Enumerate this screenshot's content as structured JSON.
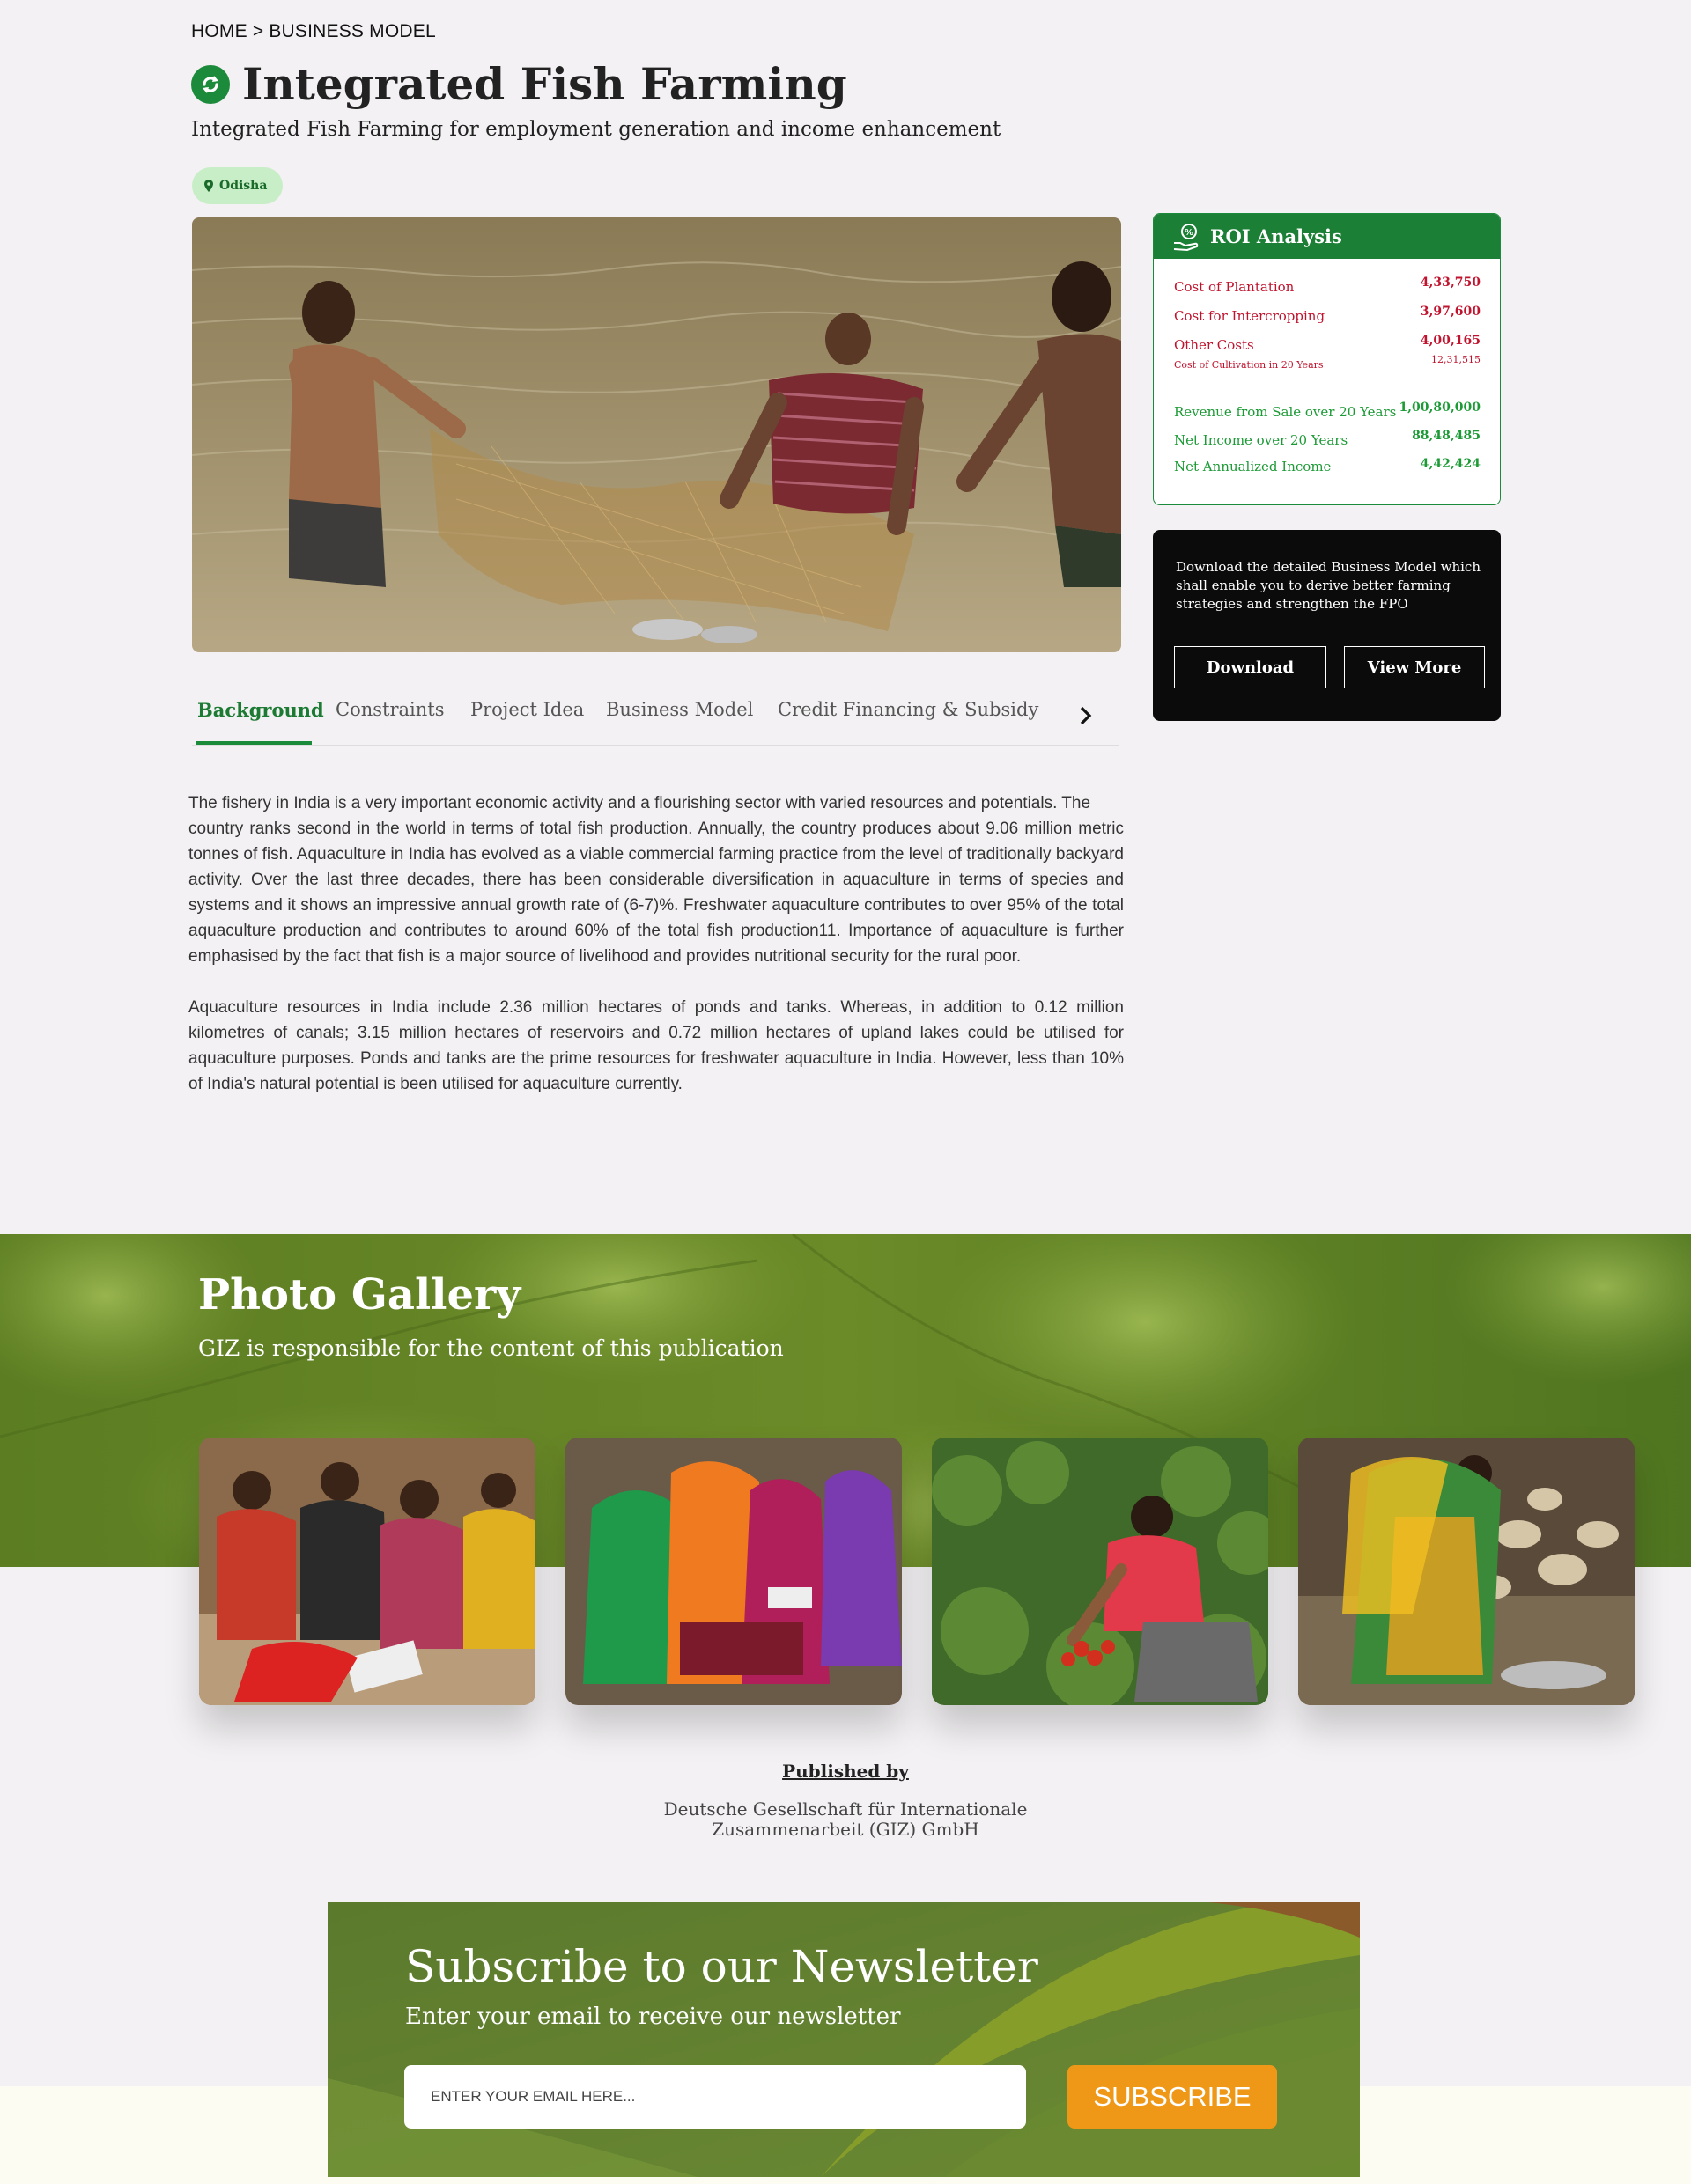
{
  "breadcrumb": "HOME > BUSINESS MODEL",
  "page": {
    "title": "Integrated Fish Farming",
    "subtitle": "Integrated Fish Farming for employment generation and income enhancement",
    "location_tag": "Odisha"
  },
  "tabs": [
    "Background",
    "Constraints",
    "Project Idea",
    "Business Model",
    "Credit Financing & Subsidy"
  ],
  "active_tab": "Background",
  "content": {
    "paragraphs": [
      "The fishery in India is a very important economic activity and a flourishing sector with varied resources and potentials. The\ncountry ranks second in the world in terms of total fish production. Annually, the country produces about 9.06 million metric tonnes of fish. Aquaculture in India has evolved as a viable commercial farming practice from the level of traditionally backyard activity. Over the last three decades, there has been considerable diversification in aquaculture in terms of species and systems and it shows an impressive annual growth rate of (6-7)%. Freshwater aquaculture contributes to over 95% of the total aquaculture production and contributes to around 60% of the total fish production11. Importance of aquaculture is further emphasised by the fact that fish is a major source of livelihood and provides nutritional security for the rural poor.",
      "Aquaculture resources in India include 2.36 million hectares of ponds and tanks. Whereas, in addition to 0.12 million kilometres of canals; 3.15 million hectares of reservoirs and 0.72 million hectares of upland lakes could be utilised for aquaculture purposes. Ponds and tanks are the prime resources for freshwater aquaculture in India. However, less than 10% of India's natural potential is been utilised for aquaculture currently."
    ]
  },
  "roi": {
    "title": "ROI Analysis",
    "rows": [
      {
        "label": "Cost of Plantation",
        "value": "4,33,750"
      },
      {
        "label": "Cost for Intercropping",
        "value": "3,97,600"
      },
      {
        "label": "Other Costs",
        "value": "4,00,165"
      },
      {
        "label": "Cost of Cultivation in 20 Years",
        "value": "12,31,515"
      },
      {
        "label": "Revenue from Sale over 20 Years",
        "value": "1,00,80,000"
      },
      {
        "label": "Net Income over 20 Years",
        "value": "88,48,485"
      },
      {
        "label": "Net Annualized Income",
        "value": "4,42,424"
      }
    ]
  },
  "download_card": {
    "text": "Download the detailed Business Model which shall enable you to derive better farming strategies and strengthen the FPO",
    "download_label": "Download",
    "view_more_label": "View More"
  },
  "gallery": {
    "title": "Photo Gallery",
    "subtitle": "GIZ is responsible for the content of this publication"
  },
  "published": {
    "label": "Published by",
    "org": "Deutsche Gesellschaft für Internationale\nZusammenarbeit (GIZ) GmbH"
  },
  "newsletter": {
    "title": "Subscribe to our Newsletter",
    "subtitle": "Enter your email to receive our newsletter",
    "placeholder": "ENTER YOUR EMAIL HERE...",
    "button": "SUBSCRIBE"
  },
  "colors": {
    "brand_green": "#1c8a3b",
    "cost_red": "#c0132e",
    "income_green": "#1c9a36",
    "subscribe_orange": "#ef9717"
  }
}
